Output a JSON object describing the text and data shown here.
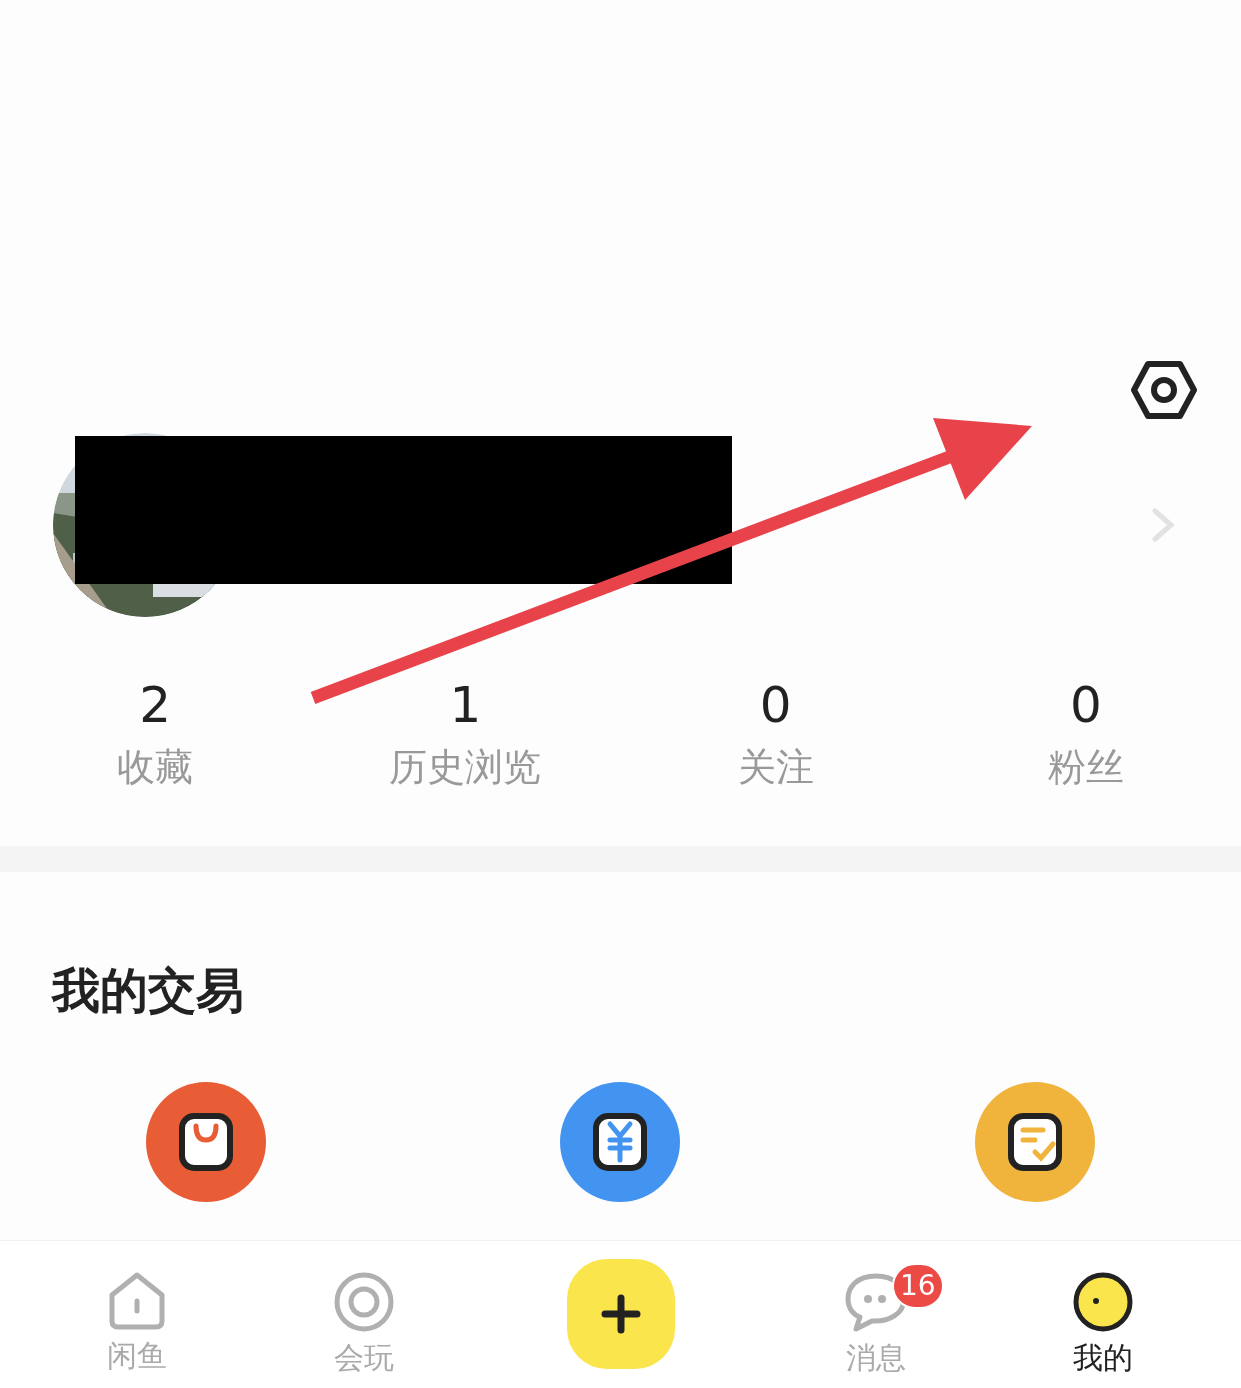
{
  "stats": [
    {
      "value": "2",
      "label": "收藏"
    },
    {
      "value": "1",
      "label": "历史浏览"
    },
    {
      "value": "0",
      "label": "关注"
    },
    {
      "value": "0",
      "label": "粉丝"
    }
  ],
  "trade_section": {
    "title": "我的交易",
    "items": [
      {
        "kind": "bag",
        "color": "#e85d35"
      },
      {
        "kind": "yuan",
        "color": "#4294f0"
      },
      {
        "kind": "checklist",
        "color": "#f0b43c"
      }
    ]
  },
  "tab_bar": {
    "items": [
      {
        "kind": "home",
        "label": "闲鱼",
        "selected": false
      },
      {
        "kind": "ring",
        "label": "会玩",
        "selected": false
      },
      {
        "kind": "publish"
      },
      {
        "kind": "chat",
        "label": "消息",
        "selected": false,
        "badge": "16"
      },
      {
        "kind": "avatar",
        "label": "我的",
        "selected": true
      }
    ]
  }
}
